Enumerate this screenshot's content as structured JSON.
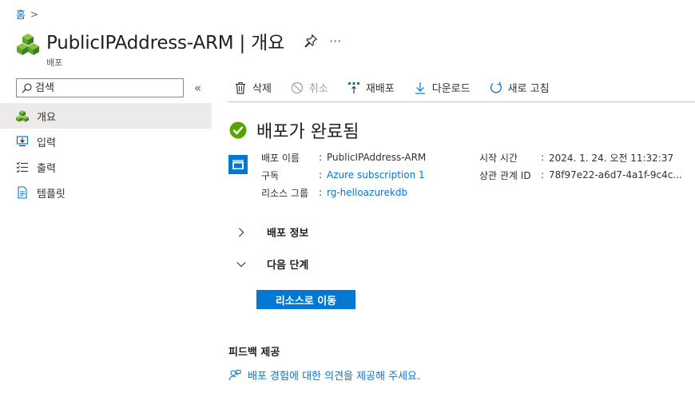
{
  "breadcrumb": {
    "home": "홈"
  },
  "header": {
    "title": "PublicIPAddress-ARM | 개요",
    "subtitle": "배포"
  },
  "search": {
    "placeholder": "검색"
  },
  "nav": {
    "items": [
      {
        "label": "개요",
        "icon": "overview-cubes-icon",
        "active": true
      },
      {
        "label": "입력",
        "icon": "input-icon"
      },
      {
        "label": "출력",
        "icon": "output-list-icon"
      },
      {
        "label": "템플릿",
        "icon": "template-document-icon"
      }
    ]
  },
  "toolbar": {
    "delete": "삭제",
    "cancel": "취소",
    "redeploy": "재배포",
    "download": "다운로드",
    "refresh": "새로 고침"
  },
  "status": {
    "title": "배포가 완료됨"
  },
  "details": {
    "deployment_name_label": "배포 이름",
    "deployment_name": "PublicIPAddress-ARM",
    "subscription_label": "구독",
    "subscription": "Azure subscription 1",
    "resource_group_label": "리소스 그룹",
    "resource_group": "rg-helloazurekdb",
    "start_time_label": "시작 시간",
    "start_time": "2024. 1. 24. 오전 11:32:37",
    "correlation_label": "상관 관계 ID",
    "correlation_id": "78f97e22-a6d7-4a1f-9c4c...",
    "colon": ":"
  },
  "sections": {
    "deployment_details": "배포 정보",
    "next_steps": "다음 단계"
  },
  "go_to_resource": "리소스로 이동",
  "feedback": {
    "title": "피드백 제공",
    "link": "배포 경험에 대한 의견을 제공해 주세요."
  },
  "colors": {
    "accent": "#0078d4",
    "success": "#57a300",
    "nav_active": "#edebe9"
  }
}
